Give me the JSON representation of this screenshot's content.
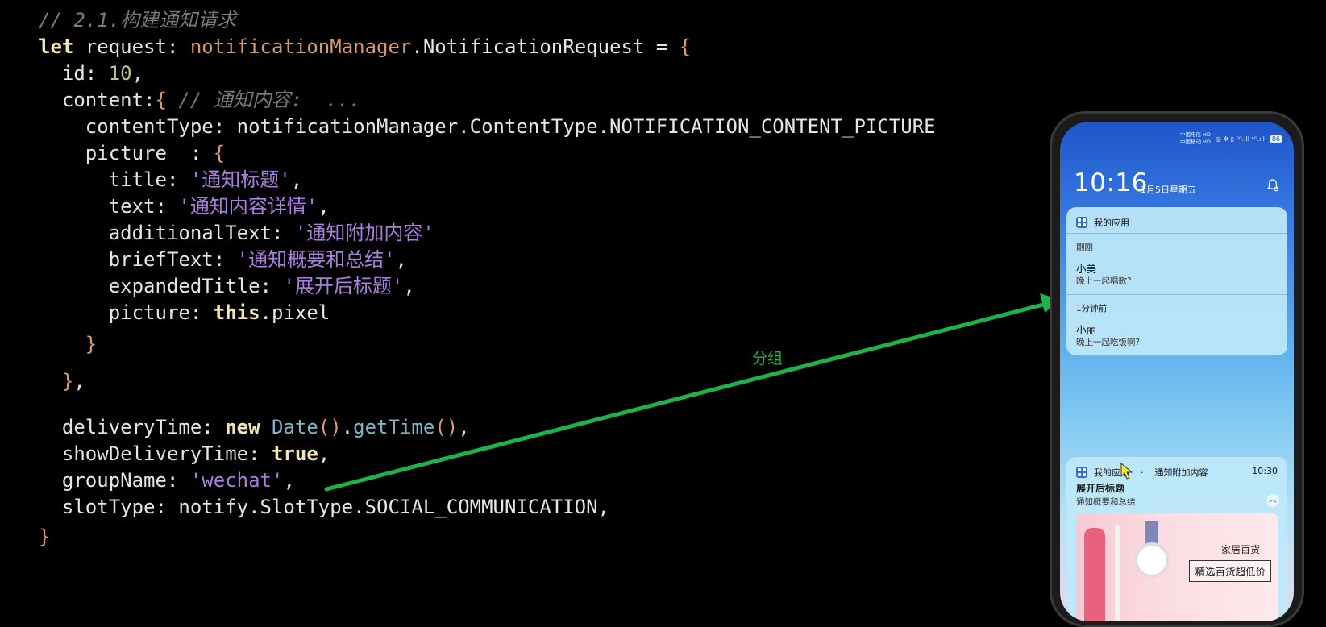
{
  "code": {
    "comment1": "// 2.1.构建通知请求",
    "l1": {
      "kw": "let",
      "a": " request: ",
      "ns": "notificationManager",
      ".b": ".NotificationRequest = ",
      "br": "{"
    },
    "l2": {
      "a": "  id: ",
      "num": "10",
      "b": ","
    },
    "l3": {
      "a": "  content:",
      "br": "{",
      "cm": " // 通知内容:  ..."
    },
    "l4": {
      "a": "    contentType: notificationManager.ContentType.NOTIFICATION_CONTENT_PICTURE"
    },
    "l5": {
      "a": "    picture  : ",
      "br": "{"
    },
    "l6": {
      "a": "      title: ",
      "str": "'通知标题'",
      "b": ","
    },
    "l7": {
      "a": "      text: ",
      "str": "'通知内容详情'",
      "b": ","
    },
    "l8": {
      "a": "      additionalText: ",
      "str": "'通知附加内容'"
    },
    "l9": {
      "a": "      briefText: ",
      "str": "'通知概要和总结'",
      "b": ","
    },
    "l10": {
      "a": "      expandedTitle: ",
      "str": "'展开后标题'",
      "b": ","
    },
    "l11": {
      "a": "      picture: ",
      "kw": "this",
      "b": ".pixel"
    },
    "l12": {
      "br": "    }"
    },
    "l13": {
      "br": "  }",
      "b": ","
    },
    "l14": {
      "a": "  deliveryTime: ",
      "kw": "new",
      "sp": " ",
      "teal": "Date",
      "br1": "()",
      "dot": ".",
      "teal2": "getTime",
      "br2": "()",
      "b": ","
    },
    "l15": {
      "a": "  showDeliveryTime: ",
      "kw": "true",
      "b": ","
    },
    "l16": {
      "a": "  groupName: ",
      "str": "'wechat'",
      "b": ","
    },
    "l17": {
      "a": "  slotType: notify.SlotType.SOCIAL_COMMUNICATION,"
    },
    "l18": {
      "br": "}"
    }
  },
  "annotation": {
    "label": "分组",
    "color": "#1fb14a"
  },
  "phone": {
    "carrier1": "中国电信 HD",
    "carrier2": "中国移动 HD",
    "status_icons": "◎ ✻ ▯ ⁵ᴳ.ıll ⁴ᴳ.ıll",
    "battery": "86",
    "clock": "10:16",
    "date": "1月5日星期五",
    "card1": {
      "app": "我的应用",
      "g1_time": "刚刚",
      "g1_name": "小美",
      "g1_msg": "晚上一起唱歌?",
      "g2_time": "1分钟前",
      "g2_name": "小丽",
      "g2_msg": "晚上一起吃饭啊?"
    },
    "card2": {
      "app": "我的应用",
      "dot": "·",
      "additional": "通知附加内容",
      "time": "10:30",
      "expanded_title": "展开后标题",
      "brief": "通知概要和总结",
      "picture_title": "家居百货",
      "picture_sub": "精选百货超低价"
    }
  }
}
